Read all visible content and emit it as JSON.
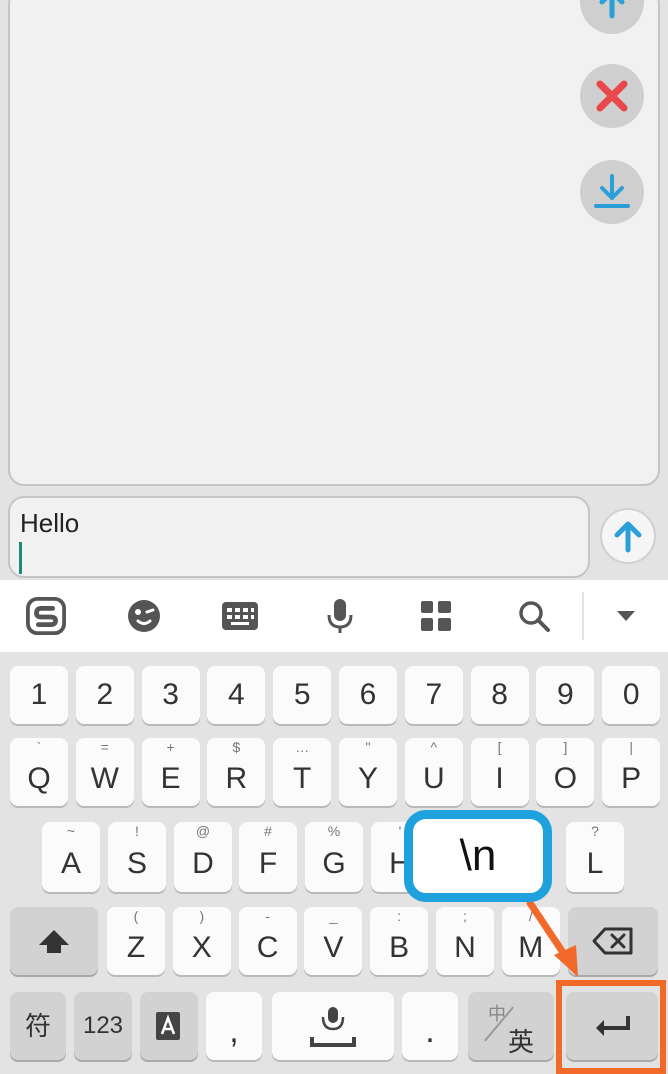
{
  "chat": {
    "side_buttons": [
      {
        "icon": "arrow-up-icon"
      },
      {
        "icon": "close-icon"
      },
      {
        "icon": "download-icon"
      }
    ]
  },
  "composer": {
    "input_value": "Hello",
    "send_icon": "arrow-up-icon"
  },
  "toolbar": {
    "items": [
      "sogou-logo-icon",
      "emoji-icon",
      "keyboard-icon",
      "microphone-icon",
      "apps-grid-icon",
      "search-icon",
      "dropdown-icon"
    ]
  },
  "keyboard": {
    "row_numbers": [
      "1",
      "2",
      "3",
      "4",
      "5",
      "6",
      "7",
      "8",
      "9",
      "0"
    ],
    "row_q": [
      {
        "main": "Q",
        "sub": "`"
      },
      {
        "main": "W",
        "sub": "="
      },
      {
        "main": "E",
        "sub": "+"
      },
      {
        "main": "R",
        "sub": "$"
      },
      {
        "main": "T",
        "sub": "…"
      },
      {
        "main": "Y",
        "sub": "\""
      },
      {
        "main": "U",
        "sub": "^"
      },
      {
        "main": "I",
        "sub": "["
      },
      {
        "main": "O",
        "sub": "]"
      },
      {
        "main": "P",
        "sub": "|"
      }
    ],
    "row_a": [
      {
        "main": "A",
        "sub": "~"
      },
      {
        "main": "S",
        "sub": "!"
      },
      {
        "main": "D",
        "sub": "@"
      },
      {
        "main": "F",
        "sub": "#"
      },
      {
        "main": "G",
        "sub": "%"
      },
      {
        "main": "H",
        "sub": "'"
      },
      {
        "main": "L",
        "sub": "?"
      }
    ],
    "row_z": [
      {
        "main": "Z",
        "sub": "("
      },
      {
        "main": "X",
        "sub": ")"
      },
      {
        "main": "C",
        "sub": "-"
      },
      {
        "main": "V",
        "sub": "_"
      },
      {
        "main": "B",
        "sub": ":"
      },
      {
        "main": "N",
        "sub": ";"
      },
      {
        "main": "M",
        "sub": "/"
      }
    ],
    "bottom": {
      "symbols": "符",
      "numbers": "123",
      "comma": ",",
      "period": ".",
      "lang_top": "中",
      "lang_bottom": "英"
    }
  },
  "annotation": {
    "callout_text": "\\n",
    "accent_blue": "#1fa1de",
    "accent_orange": "#f26a2a"
  }
}
